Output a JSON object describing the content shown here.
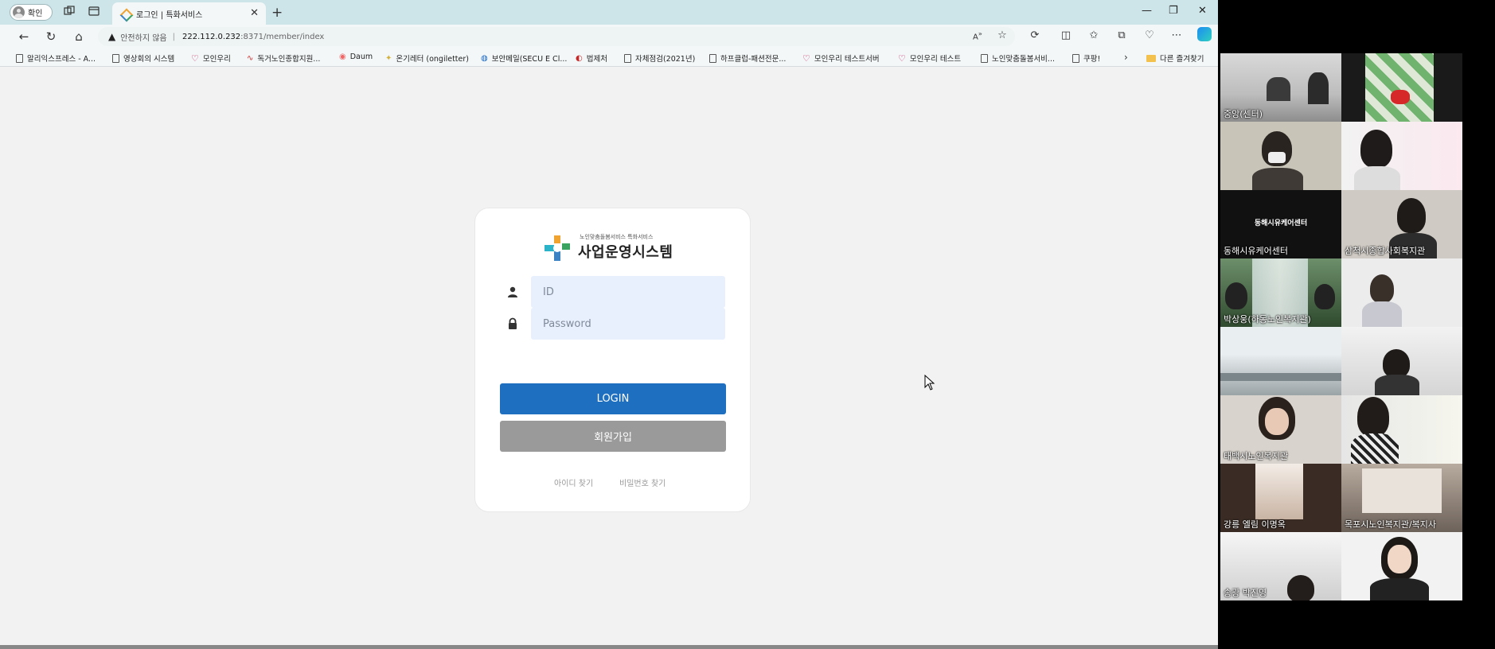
{
  "browser": {
    "profile_label": "확인",
    "tab_title": "로그인 | 특화서비스",
    "address": {
      "security_label": "안전하지 않음",
      "host": "222.112.0.232",
      "path": ":8371/member/index"
    },
    "bookmarks": [
      {
        "label": "알리익스프레스 - A...",
        "icon": "page-icon"
      },
      {
        "label": "영상회의 시스템",
        "icon": "page-icon"
      },
      {
        "label": "모인우리",
        "icon": "heart-icon"
      },
      {
        "label": "독거노인종합지원...",
        "icon": "wave-icon"
      },
      {
        "label": "Daum",
        "icon": "daum-icon"
      },
      {
        "label": "온기레터 (ongiletter)",
        "icon": "sparkle-icon"
      },
      {
        "label": "보안메일(SECU E Cl...",
        "icon": "shield-icon"
      },
      {
        "label": "법제처",
        "icon": "flag-icon"
      },
      {
        "label": "자체점검(2021년)",
        "icon": "page-icon"
      },
      {
        "label": "하프클럽-패션전문...",
        "icon": "page-icon"
      },
      {
        "label": "모인우리 테스트서버",
        "icon": "heart-icon"
      },
      {
        "label": "모인우리 테스트",
        "icon": "heart-icon"
      },
      {
        "label": "노인맞춤돌봄서비...",
        "icon": "page-icon"
      },
      {
        "label": "쿠팡!",
        "icon": "page-icon"
      }
    ],
    "other_bookmarks_label": "다른 즐겨찾기"
  },
  "login": {
    "logo_subtitle": "노인맞춤돌봄서비스 특화서비스",
    "logo_title": "사업운영시스템",
    "id_placeholder": "ID",
    "password_placeholder": "Password",
    "login_label": "LOGIN",
    "signup_label": "회원가입",
    "find_id_label": "아이디 찾기",
    "find_password_label": "비밀번호 찾기"
  },
  "video_call": {
    "participants": [
      {
        "name": "중앙(센터)"
      },
      {
        "name": ""
      },
      {
        "name": ""
      },
      {
        "name": ""
      },
      {
        "name": "동해시유케어센터",
        "center_text": "동해시유케어센터"
      },
      {
        "name": "삼척시종합사회복지관"
      },
      {
        "name": "박상웅(하동노인복지관)"
      },
      {
        "name": ""
      },
      {
        "name": ""
      },
      {
        "name": ""
      },
      {
        "name": "태백시노인복지관"
      },
      {
        "name": ""
      },
      {
        "name": "강릉 엘림 이명옥"
      },
      {
        "name": "목포시노인복지관/복지사"
      },
      {
        "name": "송광 박진영"
      },
      {
        "name": ""
      }
    ]
  },
  "colors": {
    "titlebar": "#cde4e8",
    "login_button": "#1f6fc1",
    "signup_button": "#9a9a9a",
    "input_bg": "#e8f0fe"
  }
}
